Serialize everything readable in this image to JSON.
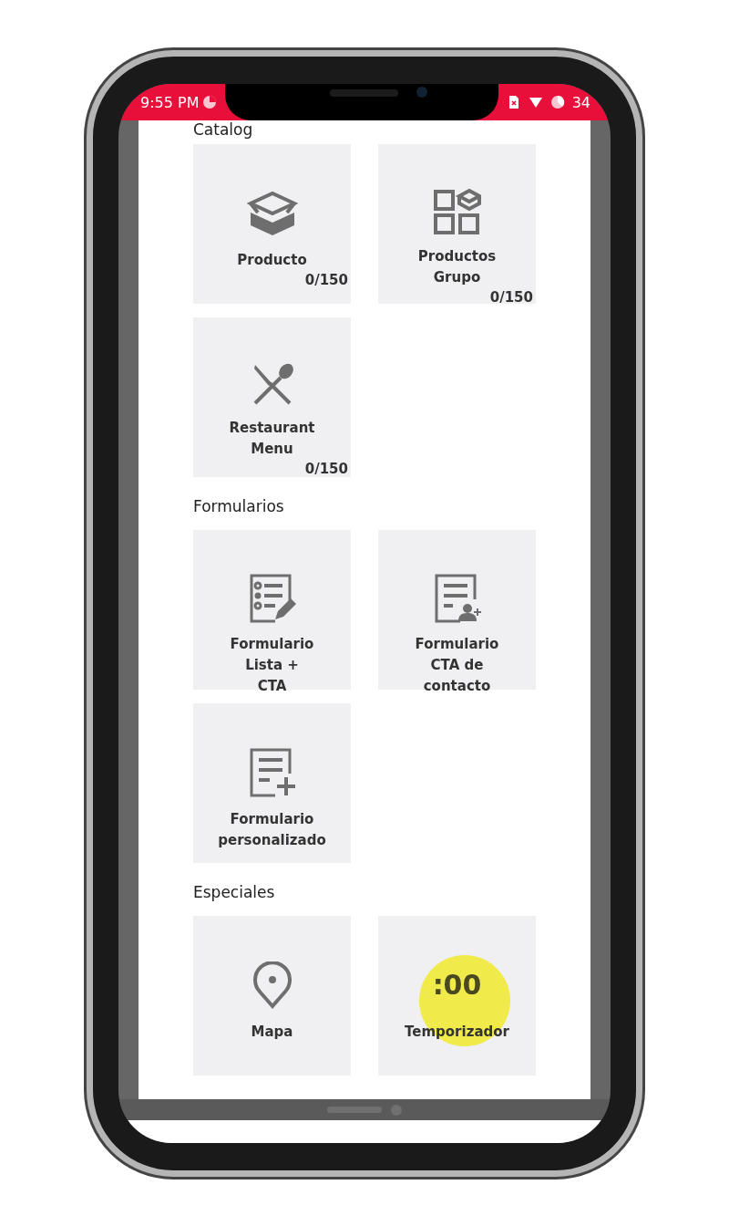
{
  "status_bar": {
    "time": "9:55 PM",
    "battery": "34"
  },
  "sections": [
    {
      "title": "Catalog",
      "tiles": [
        {
          "label": "Producto",
          "count": "0/150",
          "touched": false
        },
        {
          "label": "Productos\nGrupo",
          "count": "0/150",
          "touched": false
        },
        {
          "label": "Restaurant\nMenu",
          "count": "0/150",
          "touched": false
        }
      ]
    },
    {
      "title": "Formularios",
      "tiles": [
        {
          "label": "Formulario\nLista +\nCTA",
          "touched": false
        },
        {
          "label": "Formulario\nCTA de\ncontacto",
          "touched": false
        },
        {
          "label": "Formulario\npersonalizado",
          "touched": false
        }
      ]
    },
    {
      "title": "Especiales",
      "tiles": [
        {
          "label": "Mapa",
          "touched": false
        },
        {
          "icon_text": ":00",
          "label": "Temporizador",
          "touched": true
        }
      ]
    }
  ]
}
